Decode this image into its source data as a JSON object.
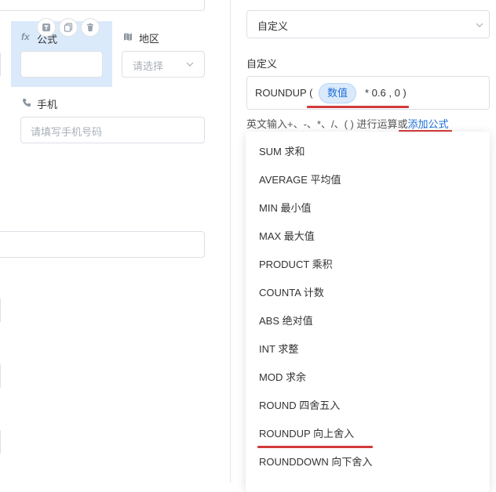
{
  "left": {
    "formula_field": {
      "label": "公式",
      "prefix": "fx"
    },
    "region_field": {
      "label": "地区",
      "placeholder": "请选择"
    },
    "phone_field": {
      "label": "手机",
      "placeholder": "请填写手机号码"
    }
  },
  "right": {
    "calc_select": {
      "value": "自定义"
    },
    "custom": {
      "label": "自定义",
      "formula_func": "ROUNDUP (",
      "formula_chip": "数值",
      "formula_rest": "* 0.6 , 0 )",
      "hint_text": "英文输入+、-、*、/、( ) 进行运算或",
      "hint_link": "添加公式"
    },
    "functions": [
      "SUM 求和",
      "AVERAGE 平均值",
      "MIN 最小值",
      "MAX 最大值",
      "PRODUCT 乘积",
      "COUNTA 计数",
      "ABS 绝对值",
      "INT 求整",
      "MOD 求余",
      "ROUND 四舍五入",
      "ROUNDUP 向上舍入",
      "ROUNDDOWN 向下舍入"
    ]
  },
  "colors": {
    "accent": "#1e6fd9",
    "annotation": "#d23a3a",
    "selected_field_bg": "#dbeafb"
  }
}
